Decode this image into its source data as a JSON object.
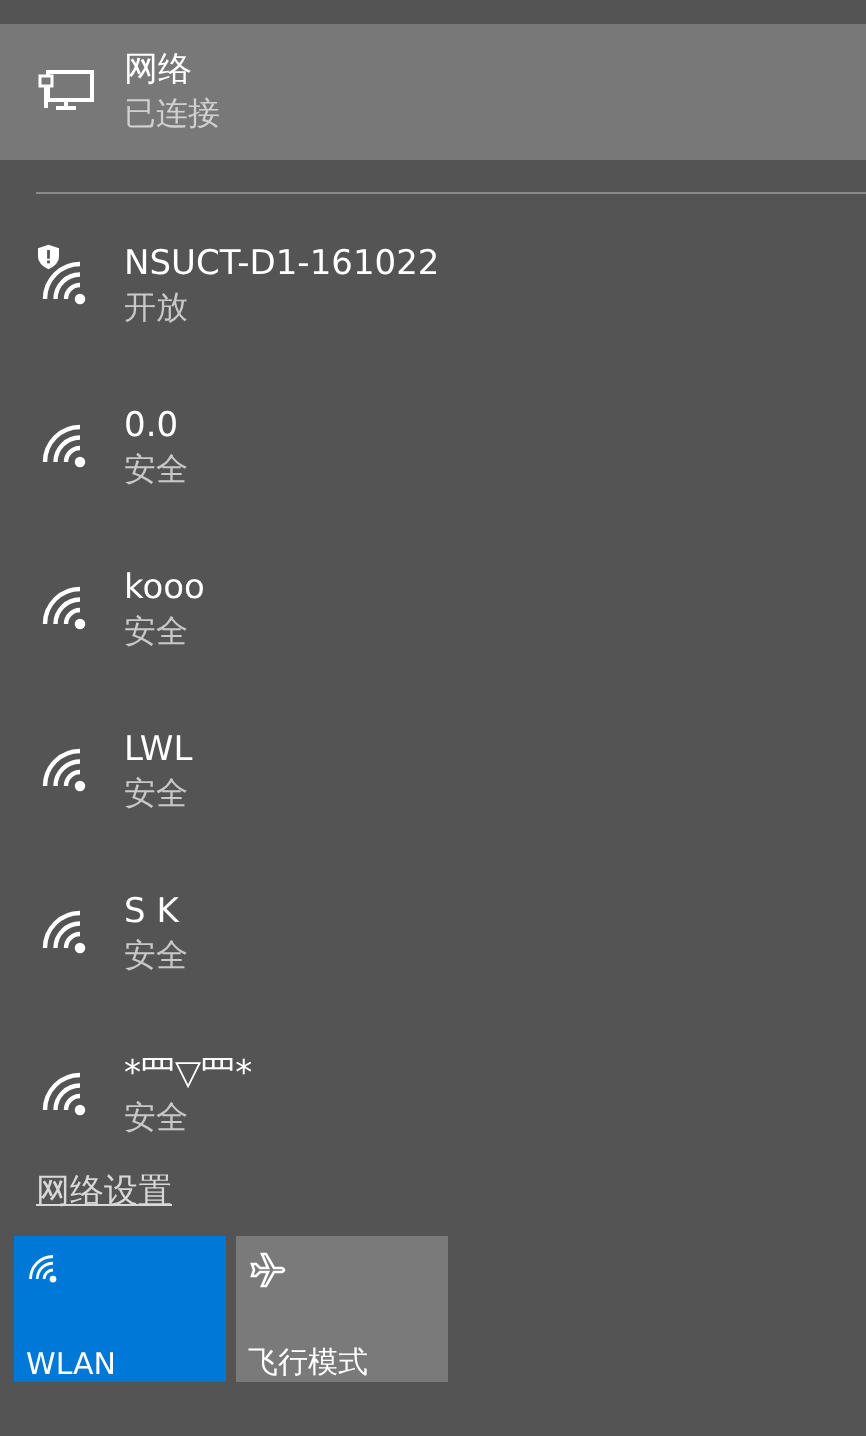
{
  "connection": {
    "title": "网络",
    "status": "已连接"
  },
  "networks": [
    {
      "name": "NSUCT-D1-161022",
      "security": "开放",
      "warning": true
    },
    {
      "name": "0.0",
      "security": "安全",
      "warning": false
    },
    {
      "name": "kooo",
      "security": "安全",
      "warning": false
    },
    {
      "name": "LWL",
      "security": "安全",
      "warning": false
    },
    {
      "name": "S  K",
      "security": "安全",
      "warning": false
    },
    {
      "name": "*罒▽罒*",
      "security": "安全",
      "warning": false
    }
  ],
  "settings_link": "网络设置",
  "tiles": [
    {
      "kind": "wifi",
      "label": "WLAN",
      "on": true
    },
    {
      "kind": "airplane",
      "label": "飞行模式",
      "on": false
    }
  ]
}
